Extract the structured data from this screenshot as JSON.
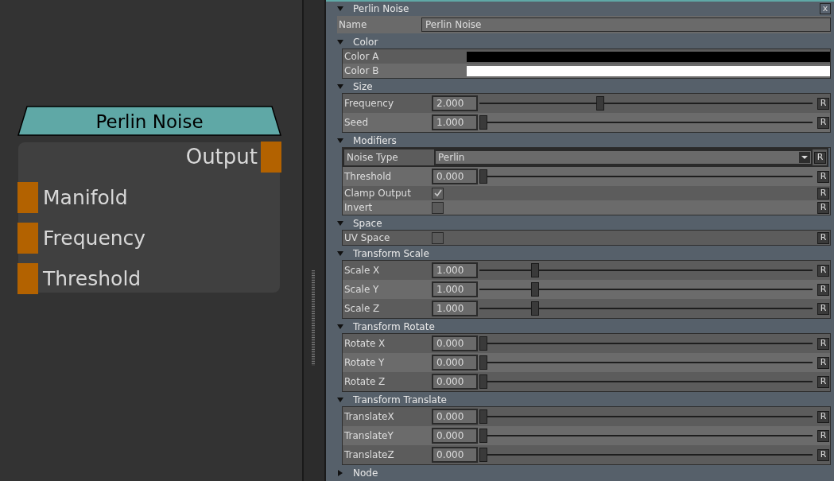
{
  "node": {
    "title": "Perlin Noise",
    "outputs": [
      "Output"
    ],
    "inputs": [
      "Manifold",
      "Frequency",
      "Threshold"
    ]
  },
  "panel": {
    "title": "Perlin Noise",
    "close": "x",
    "name": {
      "label": "Name",
      "value": "Perlin Noise"
    },
    "sections": [
      {
        "title": "Color",
        "expanded": true,
        "rows": [
          {
            "kind": "color",
            "label": "Color A",
            "color": "#000000"
          },
          {
            "kind": "color",
            "label": "Color B",
            "color": "#ffffff"
          }
        ]
      },
      {
        "title": "Size",
        "expanded": true,
        "rows": [
          {
            "kind": "slider",
            "label": "Frequency",
            "value": "2.000",
            "level": 0.36,
            "reset": "R"
          },
          {
            "kind": "slider",
            "label": "Seed",
            "value": "1.000",
            "level": 0,
            "reset": "R"
          }
        ]
      },
      {
        "title": "Modifiers",
        "expanded": true,
        "rows": [
          {
            "kind": "dropdown",
            "label": "Noise Type",
            "value": "Perlin",
            "reset": "R"
          },
          {
            "kind": "slider",
            "label": "Threshold",
            "value": "0.000",
            "level": 0,
            "reset": "R"
          },
          {
            "kind": "checkbox",
            "label": "Clamp Output",
            "checked": true,
            "reset": "R"
          },
          {
            "kind": "checkbox",
            "label": "Invert",
            "checked": false,
            "reset": "R"
          }
        ]
      },
      {
        "title": "Space",
        "expanded": true,
        "rows": [
          {
            "kind": "checkbox",
            "label": "UV Space",
            "checked": false,
            "reset": "R"
          }
        ]
      },
      {
        "title": "Transform Scale",
        "expanded": true,
        "rows": [
          {
            "kind": "slider",
            "label": "Scale X",
            "value": "1.000",
            "level": 0.16,
            "reset": "R"
          },
          {
            "kind": "slider",
            "label": "Scale Y",
            "value": "1.000",
            "level": 0.16,
            "reset": "R"
          },
          {
            "kind": "slider",
            "label": "Scale Z",
            "value": "1.000",
            "level": 0.16,
            "reset": "R"
          }
        ]
      },
      {
        "title": "Transform Rotate",
        "expanded": true,
        "rows": [
          {
            "kind": "slider",
            "label": "Rotate X",
            "value": "0.000",
            "level": 0,
            "reset": "R"
          },
          {
            "kind": "slider",
            "label": "Rotate Y",
            "value": "0.000",
            "level": 0,
            "reset": "R"
          },
          {
            "kind": "slider",
            "label": "Rotate Z",
            "value": "0.000",
            "level": 0,
            "reset": "R"
          }
        ]
      },
      {
        "title": "Transform Translate",
        "expanded": true,
        "rows": [
          {
            "kind": "slider",
            "label": "TranslateX",
            "value": "0.000",
            "level": 0,
            "reset": "R"
          },
          {
            "kind": "slider",
            "label": "TranslateY",
            "value": "0.000",
            "level": 0,
            "reset": "R"
          },
          {
            "kind": "slider",
            "label": "TranslateZ",
            "value": "0.000",
            "level": 0,
            "reset": "R"
          }
        ]
      },
      {
        "title": "Node",
        "expanded": false
      }
    ]
  }
}
